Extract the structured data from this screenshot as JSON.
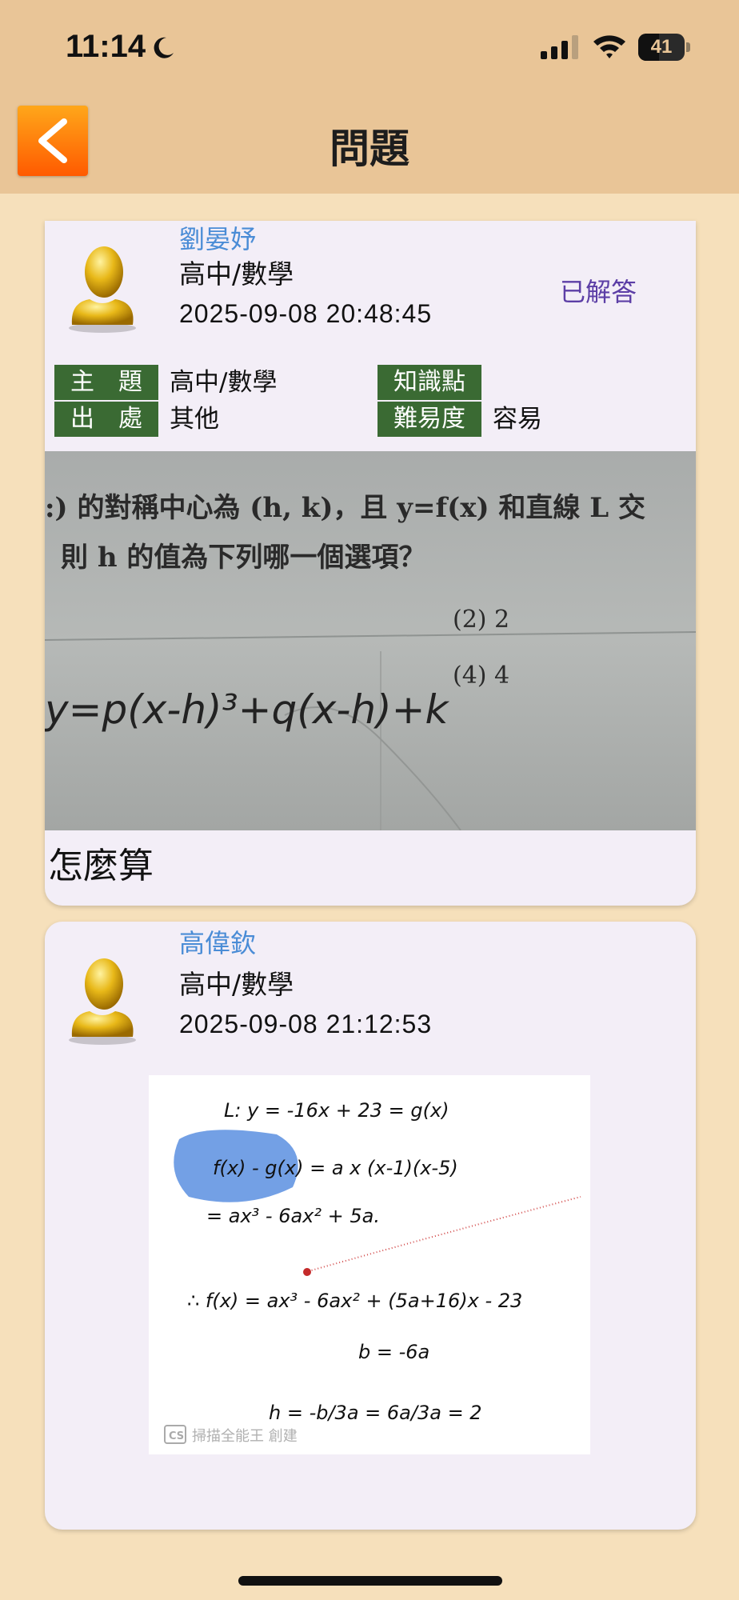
{
  "status_bar": {
    "time": "11:14",
    "battery": "41"
  },
  "nav": {
    "title": "問題",
    "back_icon": "chevron-left-icon"
  },
  "question": {
    "user_name": "劉晏妤",
    "subject": "高中/數學",
    "timestamp": "2025-09-08 20:48:45",
    "status": "已解答",
    "tags": {
      "topic_label": "主　題",
      "topic_value": "高中/數學",
      "knowledge_label": "知識點",
      "knowledge_value": "",
      "source_label": "出　處",
      "source_value": "其他",
      "difficulty_label": "難易度",
      "difficulty_value": "容易"
    },
    "photo": {
      "line1": ":) 的對稱中心為 (h, k)，且 y=f(x) 和直線 L 交",
      "line2": "則 h 的值為下列哪一個選項？",
      "option_2": "(2)  2",
      "option_4": "(4)  4",
      "handwriting": "y=p(x-h)³+q(x-h)+k"
    },
    "text": "怎麼算"
  },
  "answer": {
    "user_name": "高偉欽",
    "subject": "高中/數學",
    "timestamp": "2025-09-08 21:12:53",
    "photo": {
      "line1": "L: y = -16x + 23 = g(x)",
      "line2": "f(x) - g(x) = a x (x-1)(x-5)",
      "line3": "= ax³ - 6ax² + 5a.",
      "line4": "∴ f(x) = ax³ - 6ax² + (5a+16)x - 23",
      "line5": "b = -6a",
      "line6": "h = -b/3a = 6a/3a = 2",
      "watermark": "掃描全能王 創建",
      "watermark_badge": "CS"
    }
  },
  "colors": {
    "background": "#f6e0bb",
    "nav_bar": "#e9c597",
    "card": "#f3eef7",
    "tag_bg": "#3a6a33",
    "name_blue": "#4a8cd6",
    "status_purple": "#5c3ea6",
    "back_orange": "#ff7a00"
  }
}
